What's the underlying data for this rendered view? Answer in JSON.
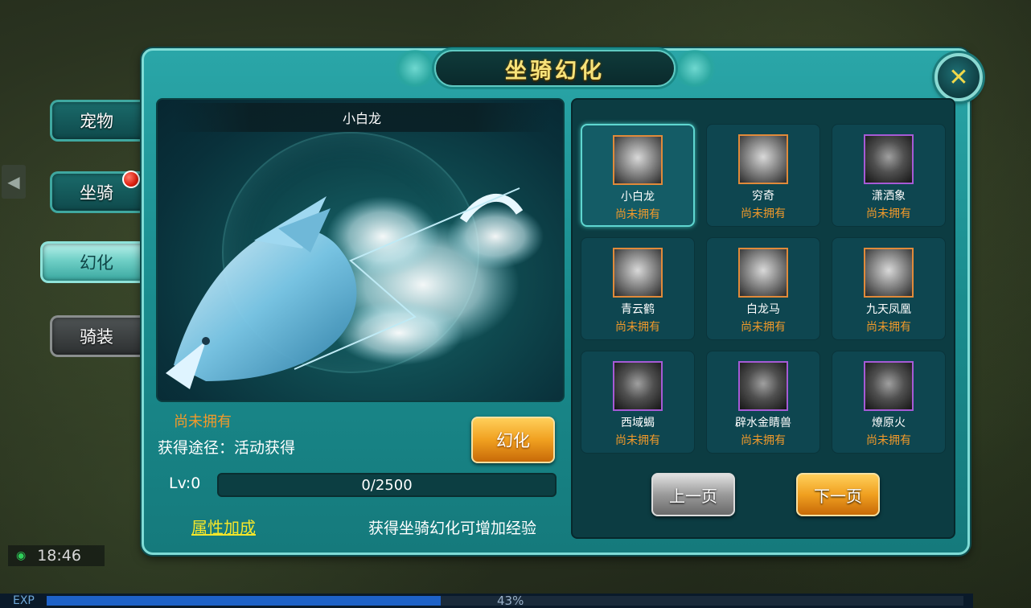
{
  "side_tabs": [
    {
      "label": "宠物",
      "state": "normal"
    },
    {
      "label": "坐骑",
      "state": "normal",
      "has_notice": true
    },
    {
      "label": "幻化",
      "state": "active"
    },
    {
      "label": "骑装",
      "state": "disabled"
    }
  ],
  "window": {
    "title": "坐骑幻化",
    "close_icon": "close-x-icon"
  },
  "preview": {
    "mount_name": "小白龙",
    "status": "尚未拥有",
    "source": "获得途径：活动获得",
    "morph_button": "幻化",
    "level_label": "Lv:0",
    "exp_text": "0/2500",
    "exp_fraction": 0,
    "attribute_link": "属性加成",
    "hint": "获得坐骑幻化可增加经验"
  },
  "mounts": [
    {
      "name": "小白龙",
      "status": "尚未拥有",
      "rarity": "orange",
      "selected": true
    },
    {
      "name": "穷奇",
      "status": "尚未拥有",
      "rarity": "orange",
      "selected": false
    },
    {
      "name": "潇洒象",
      "status": "尚未拥有",
      "rarity": "purple",
      "selected": false
    },
    {
      "name": "青云鹤",
      "status": "尚未拥有",
      "rarity": "orange",
      "selected": false
    },
    {
      "name": "白龙马",
      "status": "尚未拥有",
      "rarity": "orange",
      "selected": false
    },
    {
      "name": "九天凤凰",
      "status": "尚未拥有",
      "rarity": "orange",
      "selected": false
    },
    {
      "name": "西域蝎",
      "status": "尚未拥有",
      "rarity": "purple",
      "selected": false
    },
    {
      "name": "辟水金睛兽",
      "status": "尚未拥有",
      "rarity": "purple",
      "selected": false
    },
    {
      "name": "燎原火",
      "status": "尚未拥有",
      "rarity": "purple",
      "selected": false
    }
  ],
  "pagination": {
    "prev": "上一页",
    "next": "下一页"
  },
  "hud": {
    "time": "18:46",
    "exp_label": "EXP",
    "exp_percent": "43%",
    "exp_fraction": 0.43
  },
  "colors": {
    "accent_teal": "#2aa6a8",
    "status_orange": "#f29a2a",
    "link_yellow": "#f4e62a",
    "orange_frame": "#e08a3a",
    "purple_frame": "#a65ad6"
  }
}
